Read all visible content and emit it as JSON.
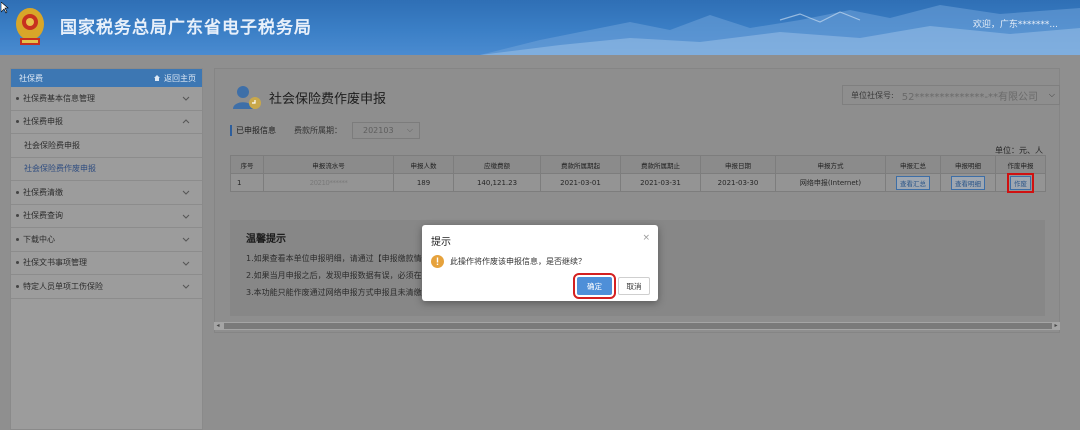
{
  "header": {
    "site_title": "国家税务总局广东省电子税务局",
    "welcome": "欢迎，广东*******..."
  },
  "sidebar": {
    "title": "社保费",
    "home_link": "返回主页",
    "items": [
      {
        "label": "社保费基本信息管理"
      },
      {
        "label": "社保费申报"
      },
      {
        "label": "社会保险费申报"
      },
      {
        "label": "社会保险费作废申报"
      },
      {
        "label": "社保费清缴"
      },
      {
        "label": "社保费查询"
      },
      {
        "label": "下载中心"
      },
      {
        "label": "社保文书事项管理"
      },
      {
        "label": "特定人员单项工伤保险"
      }
    ]
  },
  "main": {
    "page_title": "社会保险费作废申报",
    "unit_social_label": "单位社保号:",
    "unit_social_value": "52**************-**有限公司",
    "declared_tag": "已申报信息",
    "period_label": "费款所属期：",
    "period_value": "202103",
    "unit_note": "单位：元、人",
    "table": {
      "headers": [
        "序号",
        "申报流水号",
        "申报人数",
        "应缴费额",
        "费款所属期起",
        "费款所属期止",
        "申报日期",
        "申报方式",
        "申报汇总",
        "申报明细",
        "作废申报"
      ],
      "rows": [
        {
          "index": "1",
          "serial": "20210******",
          "count": "189",
          "amount": "140,121.23",
          "start": "2021-03-01",
          "end": "2021-03-31",
          "date": "2021-03-30",
          "method": "网络申报(Internet)",
          "summary_btn": "查看汇总",
          "detail_btn": "查看明细",
          "void_btn": "作废"
        }
      ]
    },
    "tips": {
      "title": "温馨提示",
      "lines": [
        "1.如果查看本单位申报明细，请通过【申报缴款情况...",
        "2.如果当月申报之后，发现申报数据有误，必须在当...",
        "3.本功能只能作废通过网络申报方式申报且未清缴的..."
      ]
    }
  },
  "dialog": {
    "title": "提示",
    "close": "×",
    "message": "此操作将作废该申报信息，是否继续？",
    "ok": "确定",
    "cancel": "取消"
  }
}
